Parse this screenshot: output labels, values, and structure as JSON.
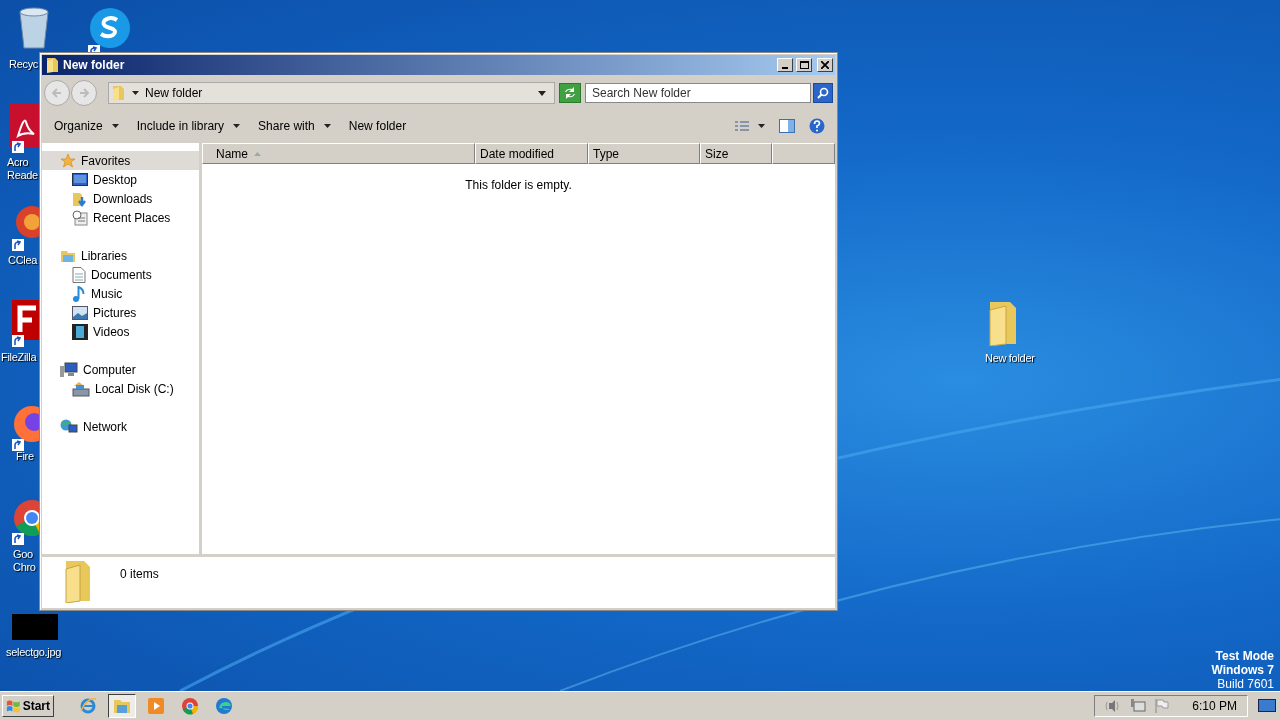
{
  "desktop_icons": [
    {
      "kind": "recycle-bin",
      "label": "Recyc",
      "shortcut": false
    },
    {
      "kind": "skype",
      "shortcut": true
    },
    {
      "kind": "pdf",
      "label": "Acro\nReade",
      "shortcut": true
    },
    {
      "kind": "ccleaner",
      "label": "CClea",
      "shortcut": true
    },
    {
      "kind": "filezilla",
      "label": "FileZilla",
      "shortcut": true
    },
    {
      "kind": "firefox",
      "label": "Fire",
      "shortcut": true
    },
    {
      "kind": "chrome",
      "label": "Goo\nChro",
      "shortcut": true
    },
    {
      "kind": "image",
      "label": "selectgo.jpg",
      "shortcut": false
    },
    {
      "kind": "folder",
      "label": "New folder",
      "shortcut": false
    }
  ],
  "window": {
    "title": "New folder",
    "address": {
      "path": "New folder"
    },
    "search": {
      "placeholder": "Search New folder"
    },
    "toolbar": [
      {
        "label": "Organize",
        "menu": true
      },
      {
        "label": "Include in library",
        "menu": true
      },
      {
        "label": "Share with",
        "menu": true
      },
      {
        "label": "New folder",
        "menu": false
      }
    ],
    "nav": [
      {
        "kind": "star",
        "label": "Favorites",
        "selected": true,
        "children": [
          {
            "kind": "desktop",
            "label": "Desktop",
            "selected": false
          },
          {
            "kind": "downloads",
            "label": "Downloads",
            "selected": false
          },
          {
            "kind": "recent",
            "label": "Recent Places",
            "selected": false
          }
        ]
      },
      {
        "kind": "libraries",
        "label": "Libraries",
        "selected": false,
        "children": [
          {
            "kind": "documents",
            "label": "Documents",
            "selected": false
          },
          {
            "kind": "music",
            "label": "Music",
            "selected": false
          },
          {
            "kind": "pictures",
            "label": "Pictures",
            "selected": false
          },
          {
            "kind": "videos",
            "label": "Videos",
            "selected": false
          }
        ]
      },
      {
        "kind": "computer",
        "label": "Computer",
        "selected": false,
        "children": [
          {
            "kind": "disk",
            "label": "Local Disk (C:)",
            "selected": false
          }
        ]
      },
      {
        "kind": "network",
        "label": "Network",
        "selected": false
      }
    ],
    "columns": [
      {
        "label": "Name",
        "sorted": true
      },
      {
        "label": "Date modified",
        "sorted": false
      },
      {
        "label": "Type",
        "sorted": false
      },
      {
        "label": "Size",
        "sorted": false
      }
    ],
    "empty_message": "This folder is empty.",
    "details": {
      "count": "0 items"
    }
  },
  "watermark_note": {
    "lines": [
      "Test Mode",
      "Windows 7",
      "Build 7601"
    ]
  },
  "taskbar": {
    "start": "Start",
    "apps": [
      {
        "kind": "ie",
        "selected": false
      },
      {
        "kind": "explorer",
        "selected": true
      },
      {
        "kind": "media",
        "selected": false
      },
      {
        "kind": "chrome",
        "selected": false
      },
      {
        "kind": "edge",
        "selected": false
      }
    ],
    "clock": "6:10 PM"
  }
}
